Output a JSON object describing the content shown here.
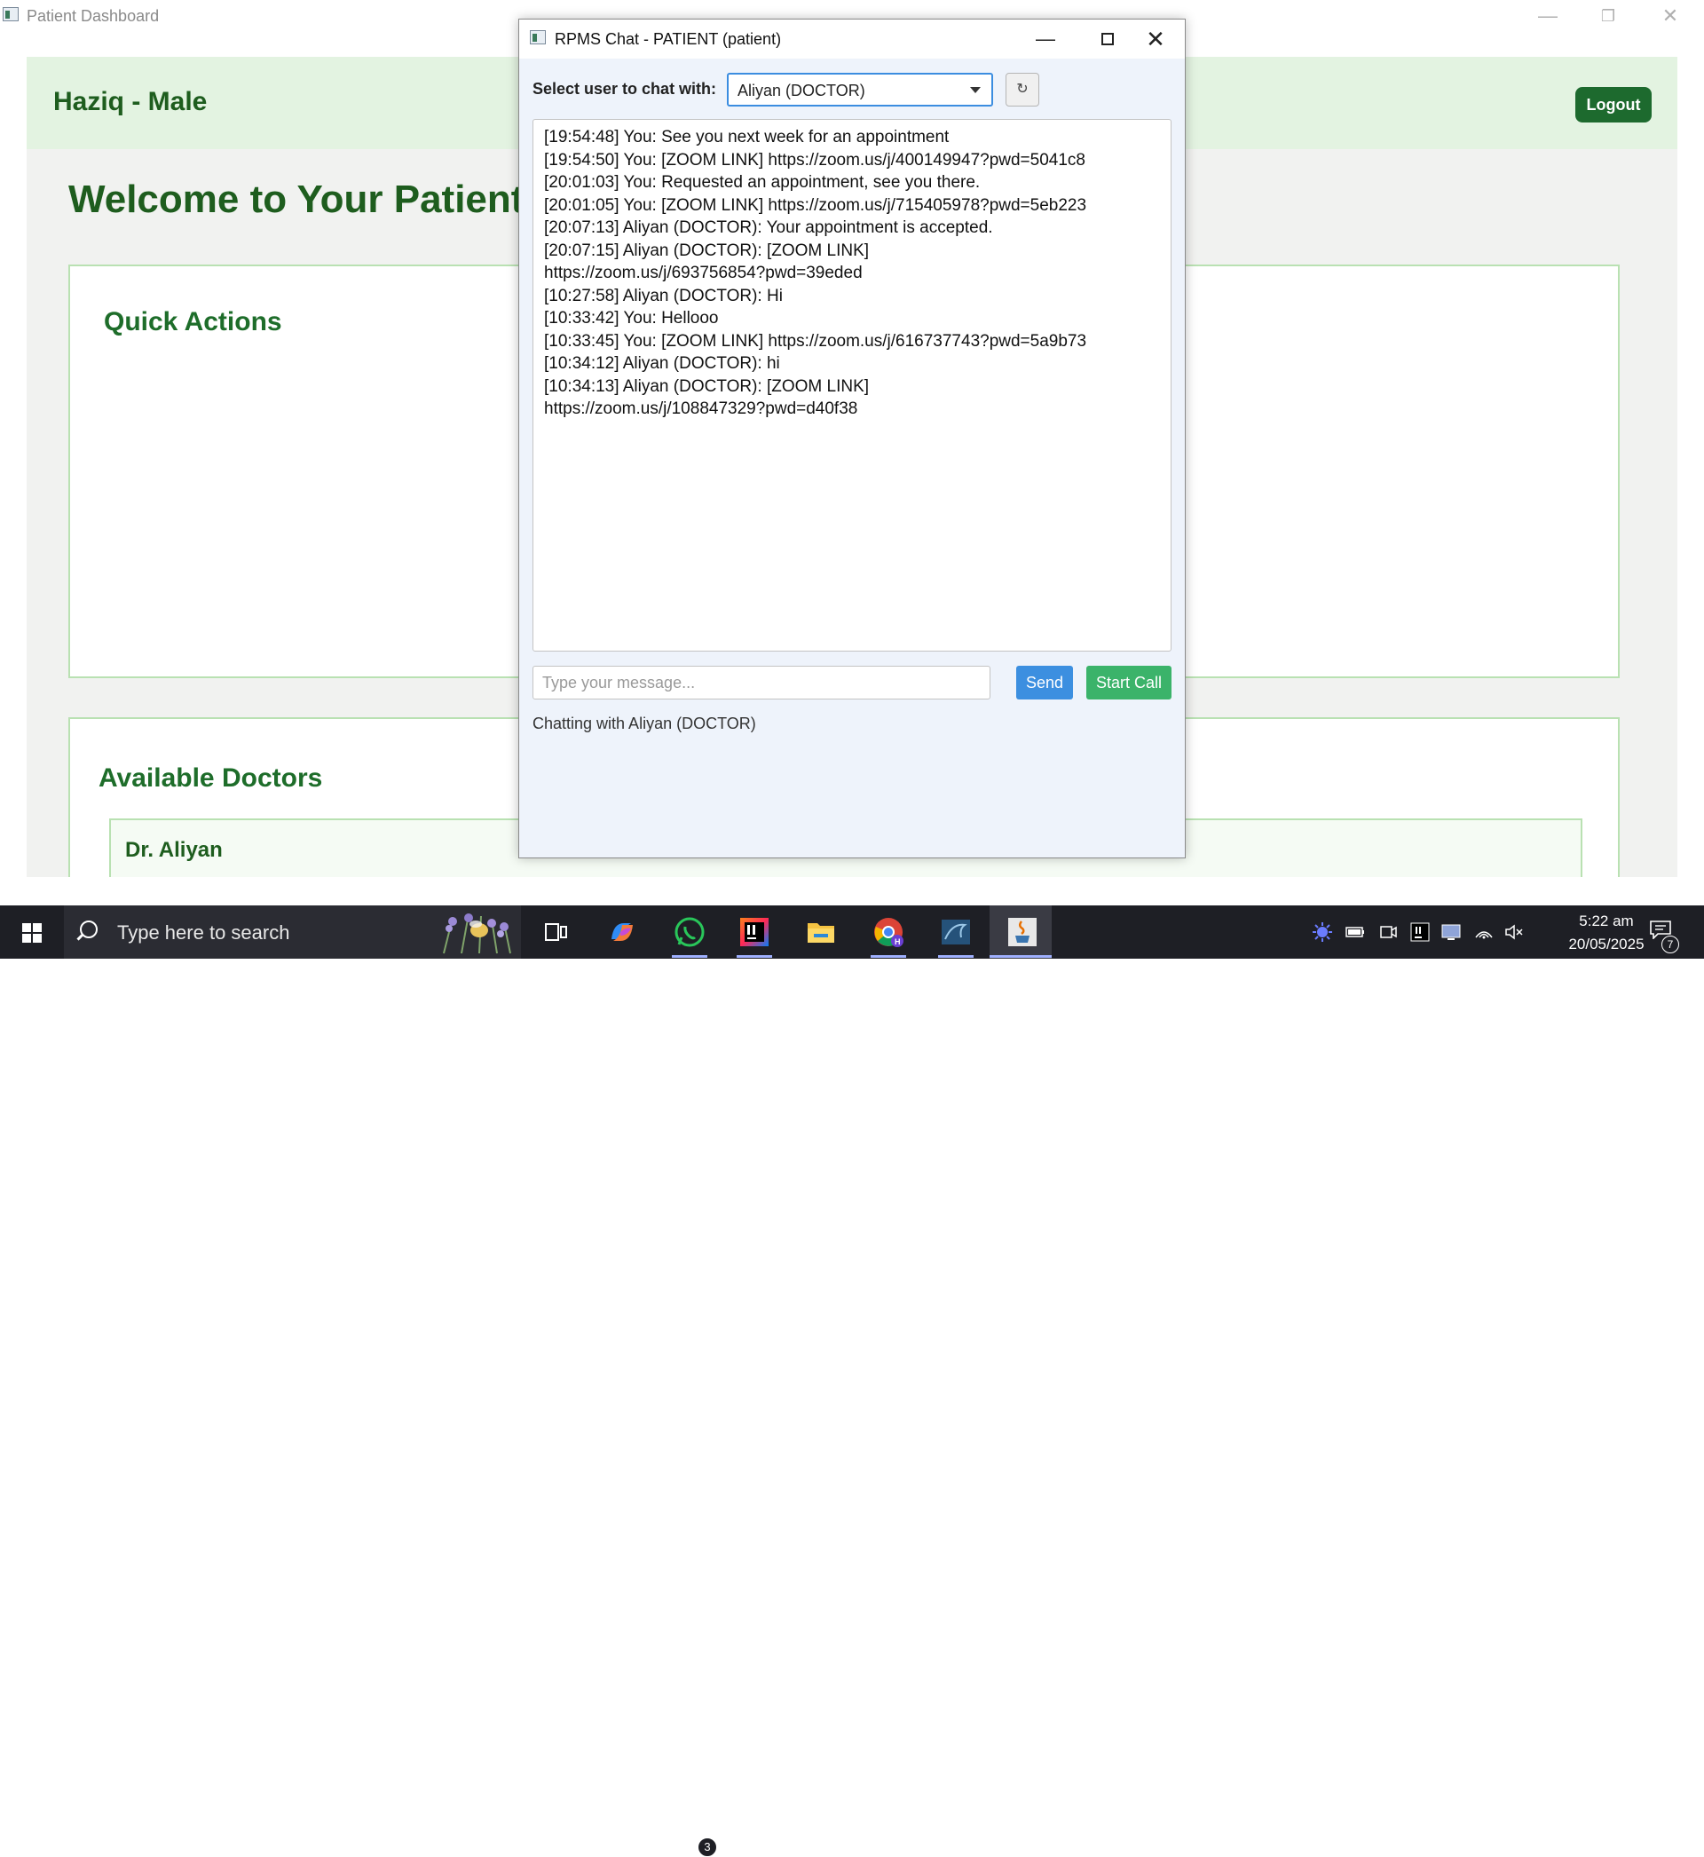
{
  "dashboard": {
    "window_title": "Patient Dashboard",
    "patient_header": "Haziq - Male",
    "logout_label": "Logout",
    "welcome": "Welcome to Your Patient",
    "quick_actions_title": "Quick Actions",
    "available_doctors_title": "Available Doctors",
    "doctor_name": "Dr. Aliyan",
    "brand_color": "#1e5d1e",
    "header_bg": "#e3f3e1"
  },
  "chat": {
    "window_title": "RPMS Chat - PATIENT (patient)",
    "select_label": "Select user to chat with:",
    "selected_user": "Aliyan (DOCTOR)",
    "refresh_icon": "↻",
    "messages": [
      "[19:54:48] You: See you next week for an appointment",
      "[19:54:50] You: [ZOOM LINK] https://zoom.us/j/400149947?pwd=5041c8",
      "[20:01:03] You: Requested an appointment, see you there.",
      "[20:01:05] You: [ZOOM LINK] https://zoom.us/j/715405978?pwd=5eb223",
      "[20:07:13] Aliyan (DOCTOR): Your appointment is accepted.",
      "[20:07:15] Aliyan (DOCTOR): [ZOOM LINK]",
      "https://zoom.us/j/693756854?pwd=39eded",
      "[10:27:58] Aliyan (DOCTOR): Hi",
      "[10:33:42] You: Hellooo",
      "[10:33:45] You: [ZOOM LINK] https://zoom.us/j/616737743?pwd=5a9b73",
      "[10:34:12] Aliyan (DOCTOR): hi",
      "[10:34:13] Aliyan (DOCTOR): [ZOOM LINK]",
      "https://zoom.us/j/108847329?pwd=d40f38"
    ],
    "input_placeholder": "Type your message...",
    "send_label": "Send",
    "call_label": "Start Call",
    "status": "Chatting with Aliyan (DOCTOR)",
    "send_color": "#3c8fe0",
    "call_color": "#3bb36a"
  },
  "taskbar": {
    "search_placeholder": "Type here to search",
    "whatsapp_badge": "3",
    "time": "5:22 am",
    "date": "20/05/2025",
    "notification_count": "7",
    "pinned_apps": [
      "task-view-icon",
      "copilot-icon",
      "whatsapp-icon",
      "intellij-icon",
      "file-explorer-icon",
      "chrome-icon",
      "mysql-workbench-icon",
      "java-icon"
    ]
  }
}
